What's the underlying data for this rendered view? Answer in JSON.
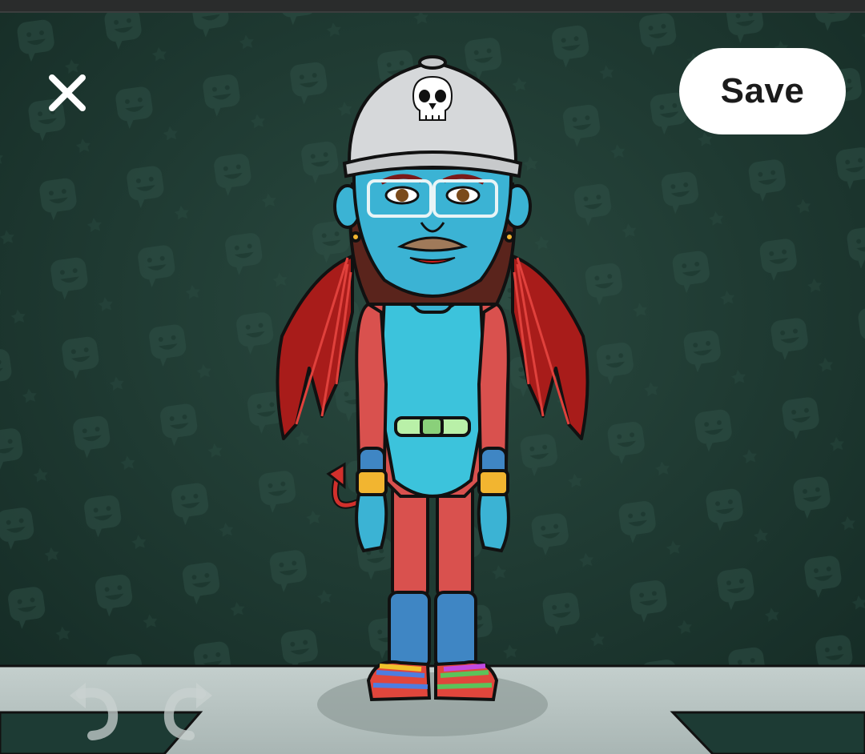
{
  "toolbar": {
    "save_label": "Save"
  },
  "icons": {
    "close": "close-icon",
    "save": "save-button",
    "undo": "undo-icon",
    "redo": "redo-icon",
    "skull": "skull-icon",
    "pattern": "smiley-chat-icon"
  },
  "colors": {
    "background": "#1e3a32",
    "floor": "#b7c3c1",
    "save_button": "#ffffff",
    "skin": "#3bb3d4",
    "suit_red": "#d9514e",
    "leotard": "#3cc3dc",
    "wings": "#b7201e",
    "hat": "#d6d8da"
  }
}
